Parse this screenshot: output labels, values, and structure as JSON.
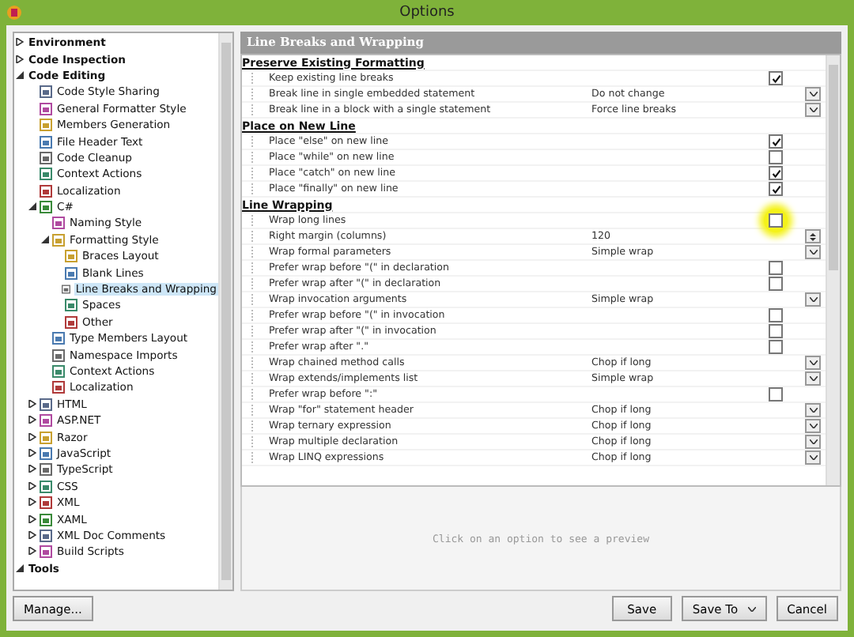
{
  "window": {
    "title": "Options"
  },
  "tree": [
    {
      "label": "Environment",
      "expanded": false,
      "selected": false
    },
    {
      "label": "Code Inspection",
      "expanded": false,
      "selected": false
    },
    {
      "label": "Code Editing",
      "expanded": true,
      "selected": false,
      "children": [
        {
          "label": "Code Style Sharing",
          "selected": false
        },
        {
          "label": "General Formatter Style",
          "selected": false
        },
        {
          "label": "Members Generation",
          "selected": false
        },
        {
          "label": "File Header Text",
          "selected": false
        },
        {
          "label": "Code Cleanup",
          "selected": false
        },
        {
          "label": "Context Actions",
          "selected": false
        },
        {
          "label": "Localization",
          "selected": false
        },
        {
          "label": "C#",
          "expanded": true,
          "selected": false,
          "children": [
            {
              "label": "Naming Style",
              "selected": false
            },
            {
              "label": "Formatting Style",
              "expanded": true,
              "selected": false,
              "children": [
                {
                  "label": "Braces Layout",
                  "selected": false
                },
                {
                  "label": "Blank Lines",
                  "selected": false
                },
                {
                  "label": "Line Breaks and Wrapping",
                  "selected": true
                },
                {
                  "label": "Spaces",
                  "selected": false
                },
                {
                  "label": "Other",
                  "selected": false
                }
              ]
            },
            {
              "label": "Type Members Layout",
              "selected": false
            },
            {
              "label": "Namespace Imports",
              "selected": false
            },
            {
              "label": "Context Actions",
              "selected": false
            },
            {
              "label": "Localization",
              "selected": false
            }
          ]
        },
        {
          "label": "HTML",
          "expanded": false,
          "selected": false
        },
        {
          "label": "ASP.NET",
          "expanded": false,
          "selected": false
        },
        {
          "label": "Razor",
          "expanded": false,
          "selected": false
        },
        {
          "label": "JavaScript",
          "expanded": false,
          "selected": false
        },
        {
          "label": "TypeScript",
          "expanded": false,
          "selected": false
        },
        {
          "label": "CSS",
          "expanded": false,
          "selected": false
        },
        {
          "label": "XML",
          "expanded": false,
          "selected": false
        },
        {
          "label": "XAML",
          "expanded": false,
          "selected": false
        },
        {
          "label": "XML Doc Comments",
          "expanded": false,
          "selected": false
        },
        {
          "label": "Build Scripts",
          "expanded": false,
          "selected": false
        }
      ]
    },
    {
      "label": "Tools",
      "expanded": true,
      "selected": false
    }
  ],
  "manage_button": "Manage...",
  "panel_title": "Line Breaks and Wrapping",
  "settings": [
    {
      "kind": "header",
      "label": "Preserve Existing Formatting"
    },
    {
      "kind": "checkbox",
      "label": "Keep existing line breaks",
      "checked": true
    },
    {
      "kind": "dropdown",
      "label": "Break line in single embedded statement",
      "value": "Do not change"
    },
    {
      "kind": "dropdown",
      "label": "Break line in a block with a single statement",
      "value": "Force line breaks"
    },
    {
      "kind": "header",
      "label": "Place on New Line"
    },
    {
      "kind": "checkbox",
      "label": "Place \"else\" on new line",
      "checked": true
    },
    {
      "kind": "checkbox",
      "label": "Place \"while\" on new line",
      "checked": false
    },
    {
      "kind": "checkbox",
      "label": "Place \"catch\" on new line",
      "checked": true
    },
    {
      "kind": "checkbox",
      "label": "Place \"finally\" on new line",
      "checked": true
    },
    {
      "kind": "header",
      "label": "Line Wrapping"
    },
    {
      "kind": "checkbox",
      "label": "Wrap long lines",
      "checked": false,
      "highlighted": true
    },
    {
      "kind": "spinner",
      "label": "Right margin (columns)",
      "value": "120"
    },
    {
      "kind": "dropdown",
      "label": "Wrap formal parameters",
      "value": "Simple wrap"
    },
    {
      "kind": "checkbox",
      "label": "Prefer wrap before \"(\" in declaration",
      "checked": false
    },
    {
      "kind": "checkbox",
      "label": "Prefer wrap after \"(\" in declaration",
      "checked": false
    },
    {
      "kind": "dropdown",
      "label": "Wrap invocation arguments",
      "value": "Simple wrap"
    },
    {
      "kind": "checkbox",
      "label": "Prefer wrap before \"(\" in invocation",
      "checked": false
    },
    {
      "kind": "checkbox",
      "label": "Prefer wrap after \"(\" in invocation",
      "checked": false
    },
    {
      "kind": "checkbox",
      "label": "Prefer wrap after \".\"",
      "checked": false
    },
    {
      "kind": "dropdown",
      "label": "Wrap chained method calls",
      "value": "Chop if long"
    },
    {
      "kind": "dropdown",
      "label": "Wrap extends/implements list",
      "value": "Simple wrap"
    },
    {
      "kind": "checkbox",
      "label": "Prefer wrap before \":\"",
      "checked": false
    },
    {
      "kind": "dropdown",
      "label": "Wrap \"for\" statement header",
      "value": "Chop if long"
    },
    {
      "kind": "dropdown",
      "label": "Wrap ternary expression",
      "value": "Chop if long"
    },
    {
      "kind": "dropdown",
      "label": "Wrap multiple declaration",
      "value": "Chop if long"
    },
    {
      "kind": "dropdown",
      "label": "Wrap LINQ expressions",
      "value": "Chop if long"
    }
  ],
  "preview_hint": "Click on an option to see a preview",
  "buttons": [
    {
      "kind": "plain",
      "label": "Save"
    },
    {
      "kind": "split",
      "label": "Save To"
    },
    {
      "kind": "plain",
      "label": "Cancel"
    }
  ]
}
